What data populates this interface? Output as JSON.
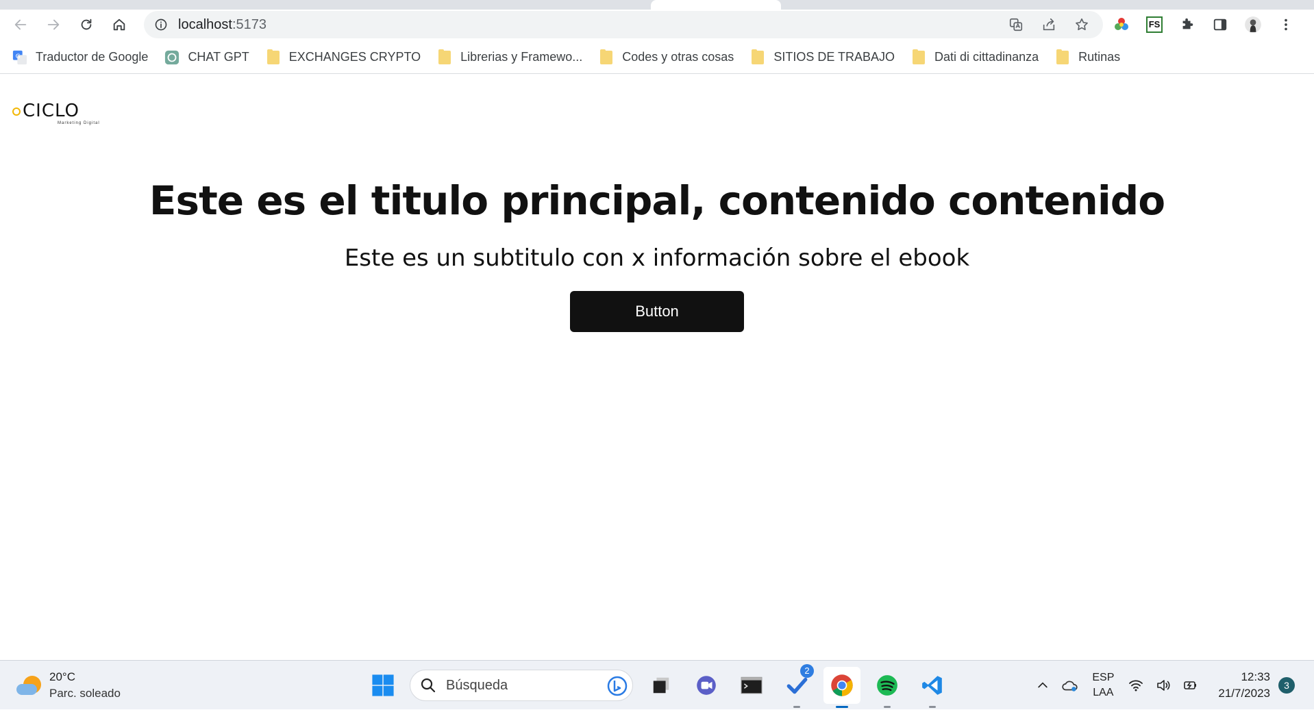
{
  "browser": {
    "url_host": "localhost",
    "url_port": ":5173",
    "bookmarks": [
      {
        "label": "Traductor de Google",
        "icon": "google-translate-icon"
      },
      {
        "label": "CHAT GPT",
        "icon": "chatgpt-icon"
      },
      {
        "label": "EXCHANGES CRYPTO",
        "icon": "folder-icon"
      },
      {
        "label": "Librerias y Framewo...",
        "icon": "folder-icon"
      },
      {
        "label": "Codes y otras cosas",
        "icon": "folder-icon"
      },
      {
        "label": "SITIOS DE TRABAJO",
        "icon": "folder-icon"
      },
      {
        "label": "Dati di cittadinanza",
        "icon": "folder-icon"
      },
      {
        "label": "Rutinas",
        "icon": "folder-icon"
      }
    ],
    "extensions": {
      "fs_label": "FS"
    }
  },
  "page": {
    "logo": {
      "word": "CICLO",
      "tagline": "Marketing Digital"
    },
    "hero": {
      "title": "Este es el titulo principal, contenido contenido",
      "subtitle": "Este es un subtitulo con x información sobre el ebook",
      "button_label": "Button"
    }
  },
  "taskbar": {
    "weather": {
      "temperature": "20°C",
      "condition": "Parc. soleado"
    },
    "search_placeholder": "Búsqueda",
    "todo_badge": "2",
    "language": {
      "line1": "ESP",
      "line2": "LAA"
    },
    "clock": {
      "time": "12:33",
      "date": "21/7/2023"
    },
    "notification_count": "3"
  },
  "colors": {
    "button_bg": "#111111",
    "logo_accent": "#f2b705",
    "active_taskbar": "#0067c0"
  }
}
